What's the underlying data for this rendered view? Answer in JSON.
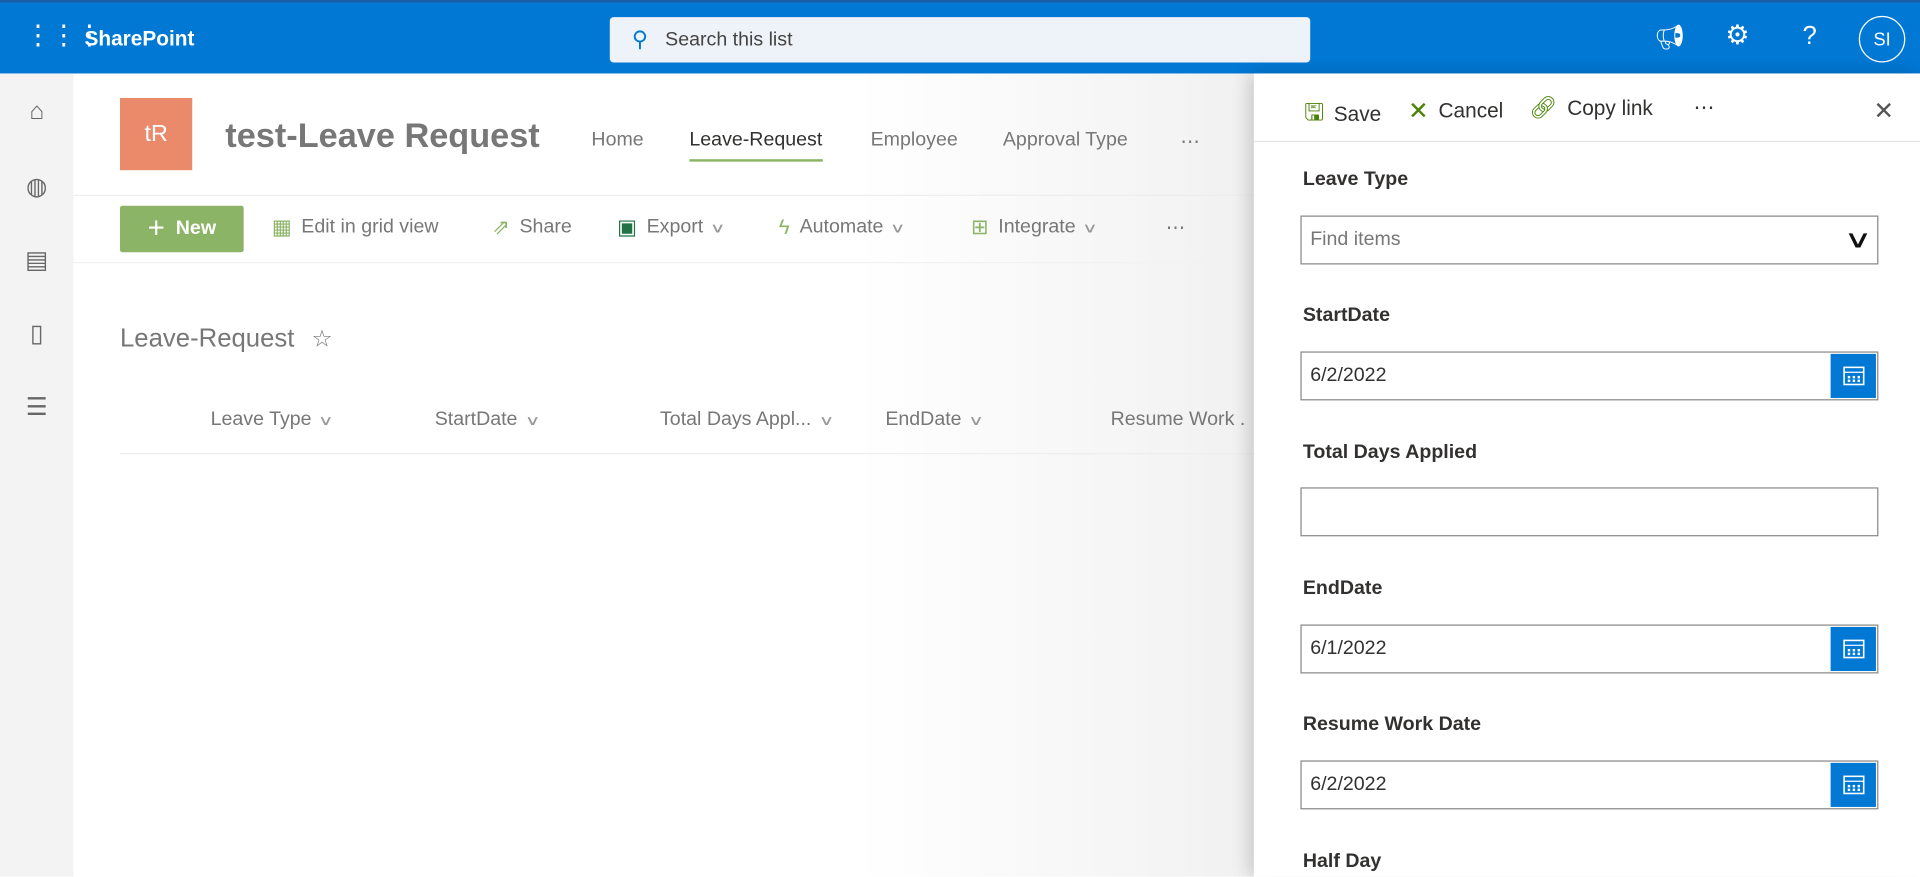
{
  "app": {
    "name": "SharePoint",
    "search_placeholder": "Search this list",
    "avatar_initials": "SI"
  },
  "site": {
    "logo": "tR",
    "title": "test-Leave Request",
    "nav": [
      "Home",
      "Leave-Request",
      "Employee",
      "Approval Type",
      "⋯"
    ],
    "active_nav": "Leave-Request"
  },
  "commands": {
    "new": "New",
    "edit_grid": "Edit in grid view",
    "share": "Share",
    "export": "Export",
    "automate": "Automate",
    "integrate": "Integrate",
    "more": "⋯"
  },
  "list": {
    "title": "Leave-Request",
    "columns": [
      "Leave Type",
      "StartDate",
      "Total Days Appl...",
      "EndDate",
      "Resume Work ."
    ]
  },
  "panel": {
    "save": "Save",
    "cancel": "Cancel",
    "copy_link": "Copy link",
    "more": "⋯",
    "fields": [
      {
        "label": "Leave Type",
        "value": "",
        "placeholder": "Find items"
      },
      {
        "label": "StartDate",
        "value": "6/2/2022"
      },
      {
        "label": "Total Days Applied",
        "value": ""
      },
      {
        "label": "EndDate",
        "value": "6/1/2022"
      },
      {
        "label": "Resume Work Date",
        "value": "6/2/2022"
      },
      {
        "label": "Half Day"
      }
    ]
  },
  "colors": {
    "brand": "#0078d4",
    "accent": "#8cb466",
    "logo": "#ea8a6a"
  }
}
